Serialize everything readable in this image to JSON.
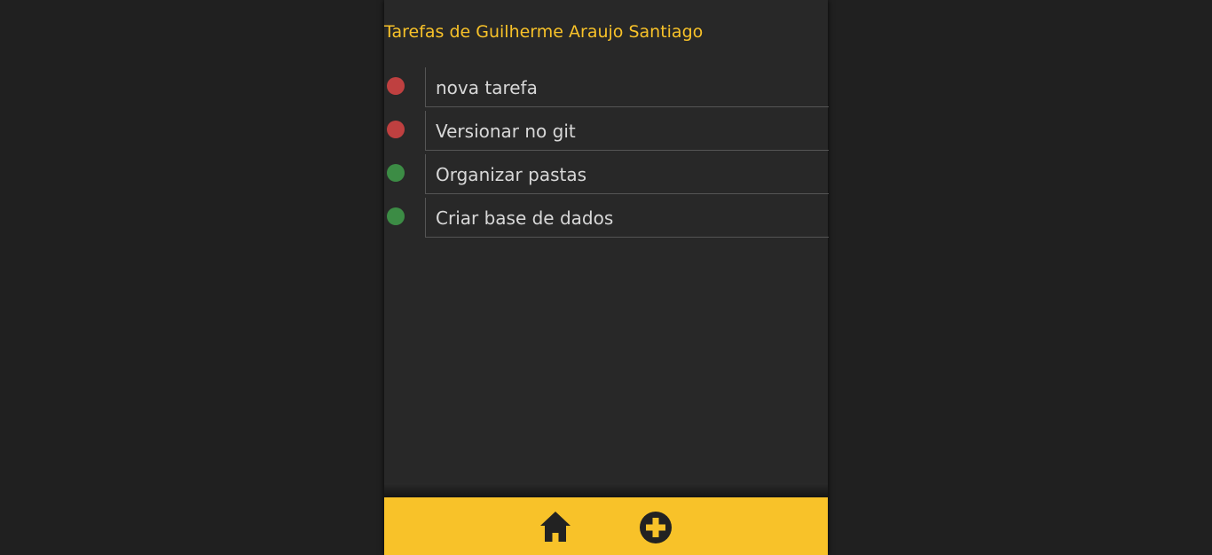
{
  "page": {
    "title": "Tarefas de Guilherme Araujo Santiago"
  },
  "tasks": [
    {
      "text": "nova tarefa",
      "status": "pending"
    },
    {
      "text": "Versionar no git",
      "status": "pending"
    },
    {
      "text": "Organizar pastas",
      "status": "done"
    },
    {
      "text": "Criar base de dados",
      "status": "done"
    }
  ],
  "colors": {
    "accent": "#f8c229",
    "pending": "#bf4040",
    "done": "#3c8c45",
    "icon": "#222222"
  },
  "nav": {
    "items": [
      {
        "name": "home",
        "icon": "home-icon"
      },
      {
        "name": "add",
        "icon": "plus-circle-icon"
      }
    ]
  }
}
